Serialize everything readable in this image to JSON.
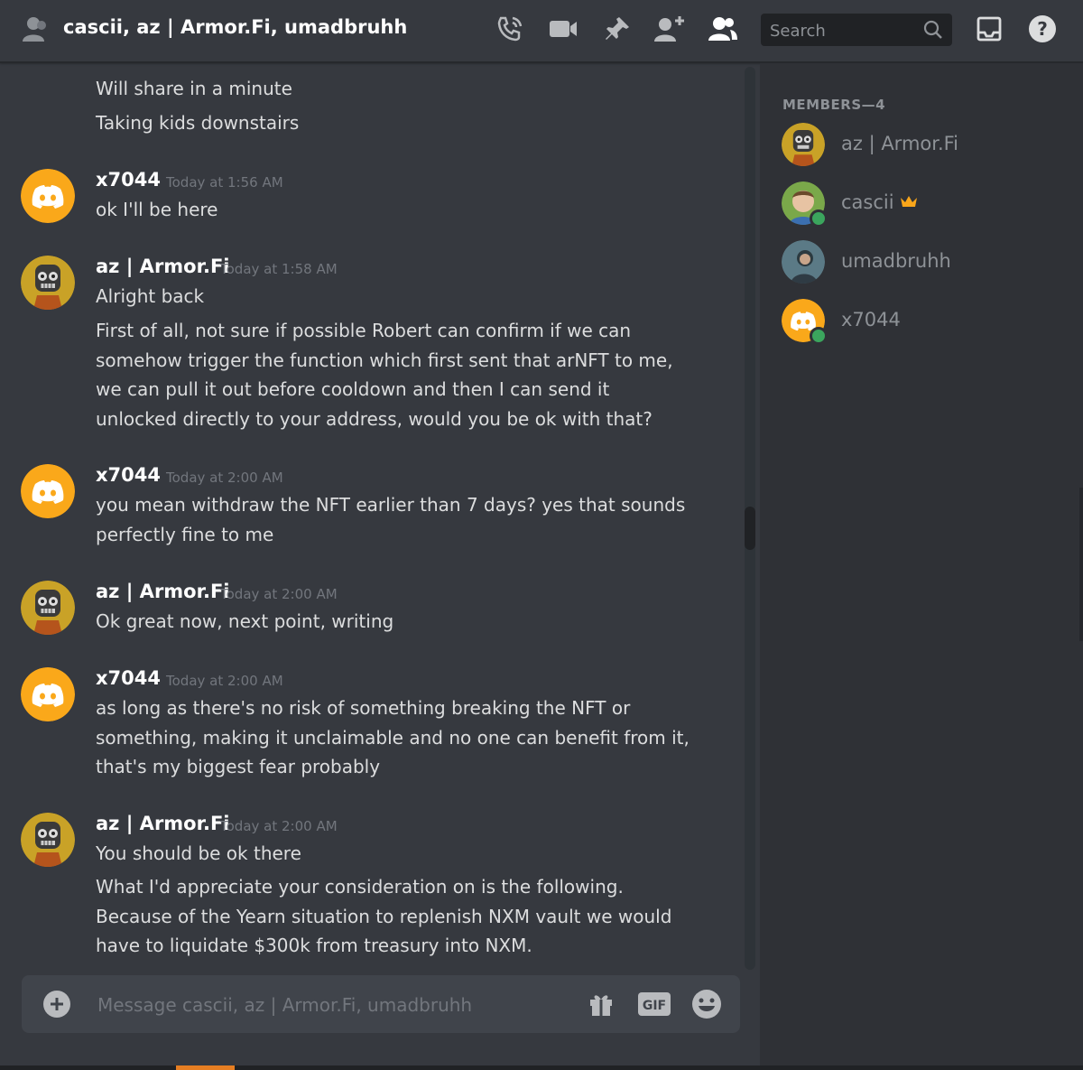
{
  "header": {
    "title": "cascii, az | Armor.Fi, umadbruhh",
    "search_placeholder": "Search",
    "icons": [
      "people-icon",
      "phone-call-icon",
      "video-camera-icon",
      "pin-icon",
      "add-friend-icon",
      "members-icon",
      "search-icon",
      "inbox-icon",
      "help-icon"
    ]
  },
  "chat": {
    "messages": [
      {
        "continuation": true,
        "lines": [
          "Will share in a minute",
          "Taking kids downstairs"
        ]
      },
      {
        "author": "x7044",
        "time": "Today at 1:56 AM",
        "avatar": "discord-default-yellow",
        "lines": [
          "ok I'll be here"
        ]
      },
      {
        "author": "az | Armor.Fi",
        "time": "Today at 1:58 AM",
        "avatar": "robot-avatar",
        "lines": [
          "Alright back"
        ]
      },
      {
        "continuation": true,
        "lines": [
          "First of all, not sure if possible Robert can confirm if we can",
          "somehow trigger the function which first sent that arNFT to me,",
          "we can pull it out before cooldown and then I can send it",
          "unlocked directly to your address, would you be ok with that?"
        ]
      },
      {
        "author": "x7044",
        "time": "Today at 2:00 AM",
        "avatar": "discord-default-yellow",
        "lines": [
          "you mean withdraw the NFT earlier than 7 days? yes that sounds",
          "perfectly fine to me"
        ]
      },
      {
        "author": "az | Armor.Fi",
        "time": "Today at 2:00 AM",
        "avatar": "robot-avatar",
        "lines": [
          "Ok great now, next point, writing"
        ]
      },
      {
        "author": "x7044",
        "time": "Today at 2:00 AM",
        "avatar": "discord-default-yellow",
        "lines": [
          "as long as there's no risk of something breaking the NFT or",
          "something, making it unclaimable and no one can benefit from it,",
          "that's my biggest fear probably"
        ]
      },
      {
        "author": "az | Armor.Fi",
        "time": "Today at 2:00 AM",
        "avatar": "robot-avatar",
        "lines": [
          "You should be ok there"
        ]
      },
      {
        "continuation": true,
        "lines": [
          "What I'd appreciate your consideration on is the following.",
          "Because of the Yearn situation to replenish NXM vault we would",
          "have to liquidate $300k from treasury into NXM."
        ]
      }
    ]
  },
  "composer": {
    "placeholder": "Message cascii, az | Armor.Fi, umadbruhh",
    "gif_label": "GIF"
  },
  "members": {
    "heading": "MEMBERS—4",
    "list": [
      {
        "name": "az | Armor.Fi",
        "online": false,
        "owner": false
      },
      {
        "name": "cascii",
        "online": true,
        "owner": true
      },
      {
        "name": "umadbruhh",
        "online": false,
        "owner": false
      },
      {
        "name": "x7044",
        "online": true,
        "owner": false
      }
    ]
  },
  "colors": {
    "background": "#36393f",
    "sidebar": "#2f3136",
    "discord_yellow": "#faa81a",
    "online_green": "#3ba55d",
    "owner_crown": "#faa61a"
  }
}
